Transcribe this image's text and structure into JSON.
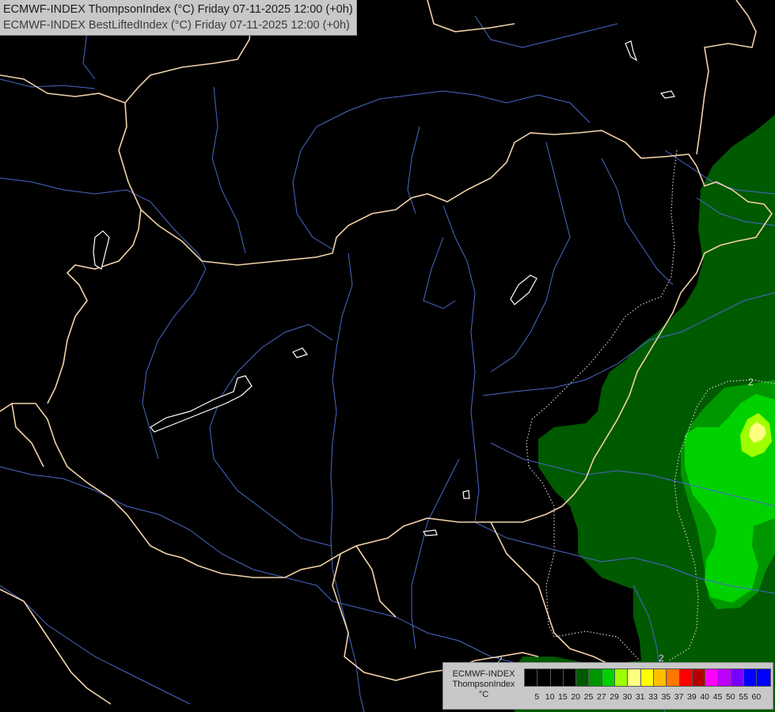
{
  "header": {
    "line1": "ECMWF-INDEX ThompsonIndex (°C) Friday 07-11-2025 12:00 (+0h)",
    "line2": "ECMWF-INDEX BestLiftedIndex (°C) Friday 07-11-2025 12:00 (+0h)"
  },
  "legend": {
    "title_line1": "ECMWF-INDEX",
    "title_line2": "ThompsonIndex",
    "title_line3": "°C",
    "levels": [
      {
        "label": "5",
        "color": "#000000"
      },
      {
        "label": "10",
        "color": "#000000"
      },
      {
        "label": "15",
        "color": "#000000"
      },
      {
        "label": "20",
        "color": "#000000"
      },
      {
        "label": "25",
        "color": "#005a00"
      },
      {
        "label": "27",
        "color": "#009600"
      },
      {
        "label": "29",
        "color": "#00d200"
      },
      {
        "label": "30",
        "color": "#a0ff00"
      },
      {
        "label": "31",
        "color": "#ffff82"
      },
      {
        "label": "33",
        "color": "#ffff00"
      },
      {
        "label": "35",
        "color": "#ffbe00"
      },
      {
        "label": "37",
        "color": "#ff7800"
      },
      {
        "label": "39",
        "color": "#ff0000"
      },
      {
        "label": "40",
        "color": "#b40000"
      },
      {
        "label": "45",
        "color": "#ff00ff"
      },
      {
        "label": "50",
        "color": "#be00ff"
      },
      {
        "label": "55",
        "color": "#7800ff"
      },
      {
        "label": "60",
        "color": "#0000ff"
      },
      {
        "label": "",
        "color": "#0000ff"
      }
    ]
  },
  "map": {
    "contour_labels": [
      "2",
      "2",
      "2",
      "2",
      "2"
    ],
    "colors": {
      "background": "#000000",
      "border": "#f2d2a8",
      "river": "#4a68c8",
      "lake": "#ffffff",
      "contour": "#cfcfcf",
      "fill_25": "#005a00",
      "fill_27": "#009600",
      "fill_29": "#00d200",
      "fill_30": "#a0ff00",
      "fill_31": "#ffff82"
    }
  }
}
